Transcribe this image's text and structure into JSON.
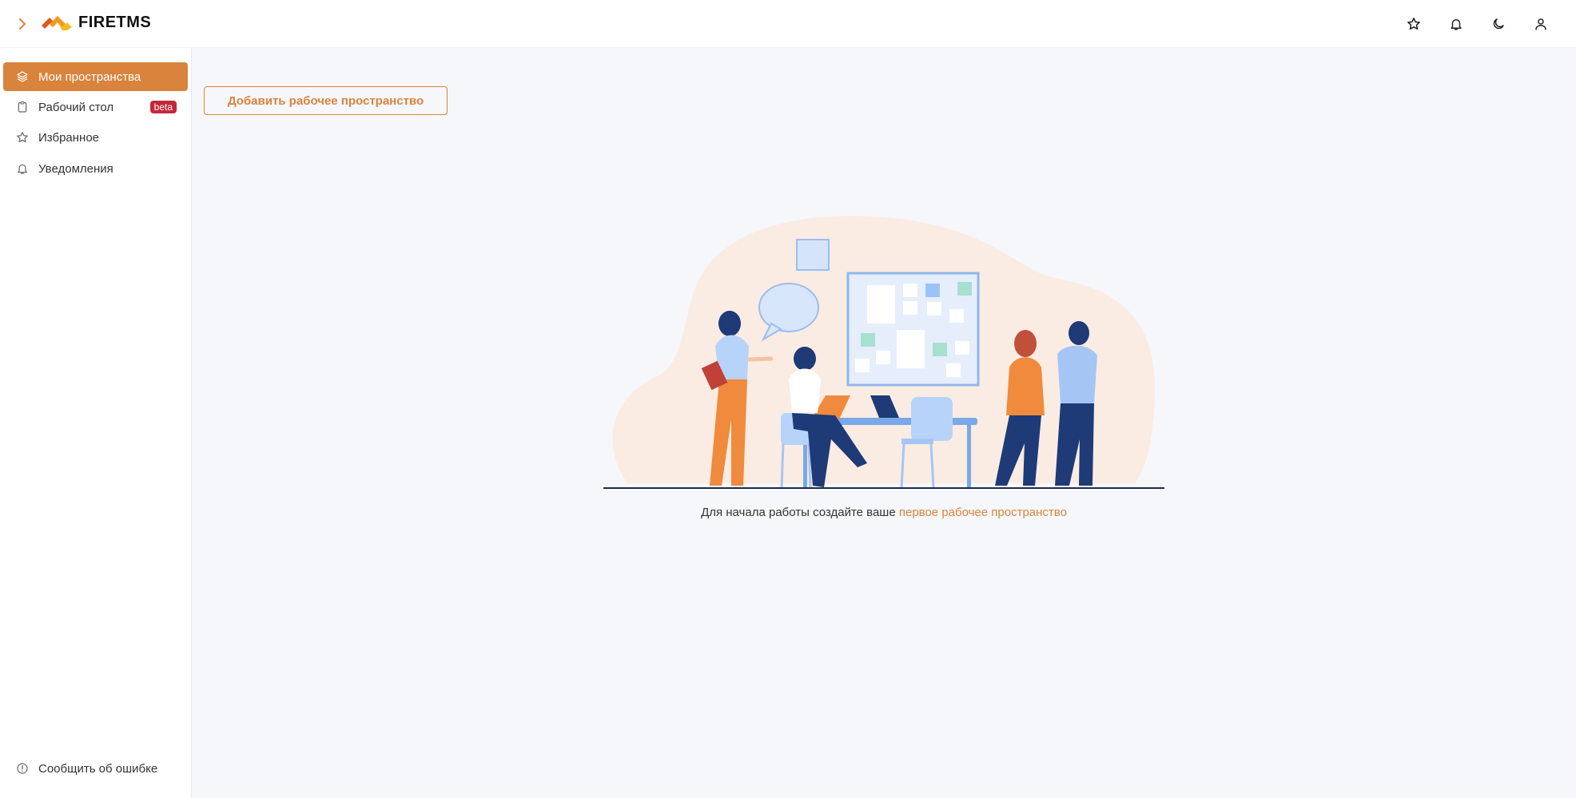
{
  "app": {
    "brand": "FIRETMS"
  },
  "header": {
    "actions": [
      "star-icon",
      "bell-icon",
      "moon-icon",
      "user-icon"
    ]
  },
  "sidebar": {
    "items": [
      {
        "label": "Мои пространства",
        "icon": "layers-icon",
        "active": true
      },
      {
        "label": "Рабочий стол",
        "icon": "clipboard-icon",
        "badge": "beta"
      },
      {
        "label": "Избранное",
        "icon": "star-icon"
      },
      {
        "label": "Уведомления",
        "icon": "bell-icon"
      }
    ],
    "footer": {
      "label": "Сообщить об ошибке",
      "icon": "info-icon"
    }
  },
  "main": {
    "add_button_label": "Добавить рабочее пространство",
    "empty_text": "Для начала работы создайте ваше",
    "empty_link": "первое рабочее пространство"
  },
  "colors": {
    "accent": "#d9833d",
    "badge": "#c5283a",
    "background": "#f6f7fb"
  }
}
